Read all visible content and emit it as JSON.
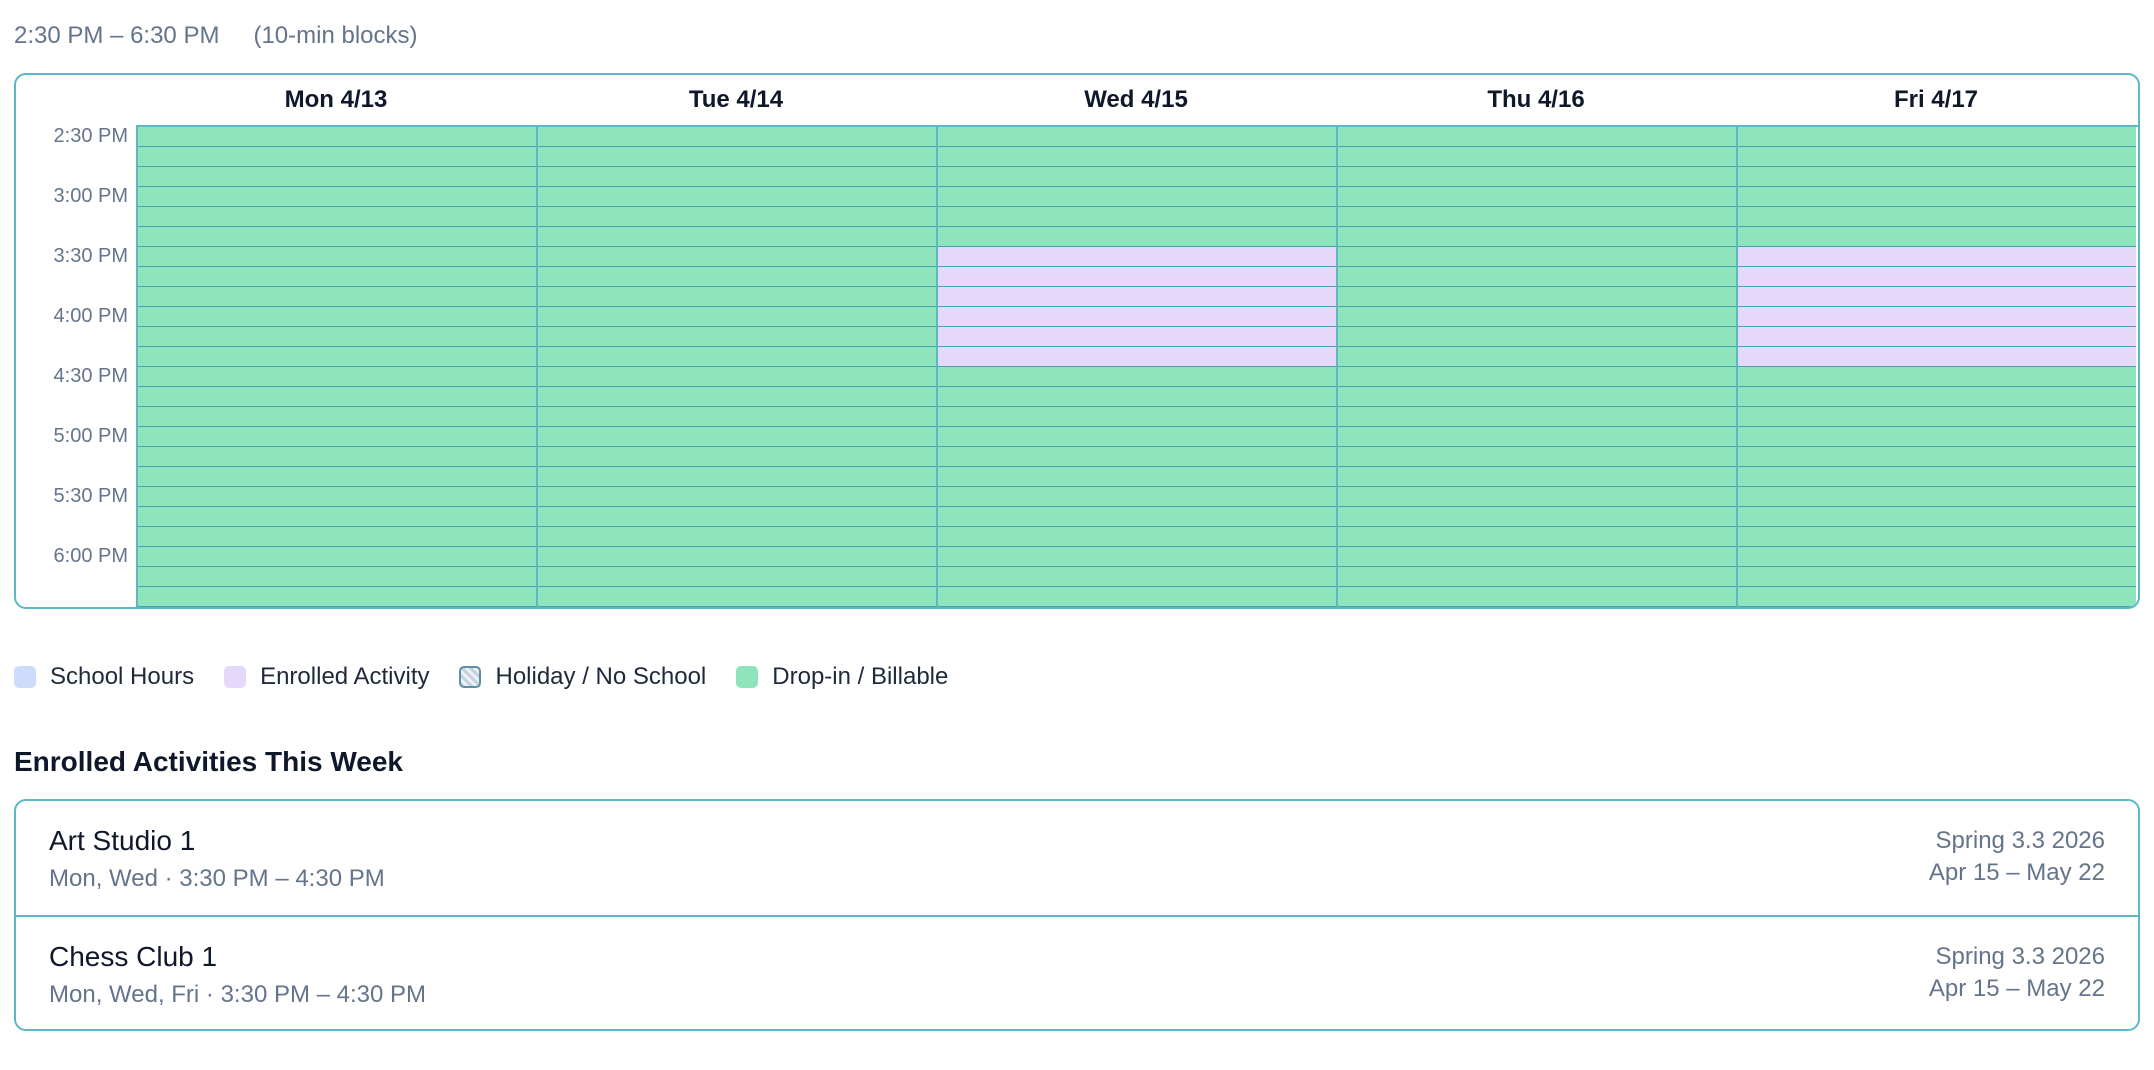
{
  "range": {
    "text": "2:30 PM – 6:30 PM",
    "note": "(10-min blocks)"
  },
  "days": [
    {
      "label": "Mon 4/13",
      "cells": [
        "d",
        "d",
        "d",
        "d",
        "d",
        "d",
        "d",
        "d",
        "d",
        "d",
        "d",
        "d",
        "d",
        "d",
        "d",
        "d",
        "d",
        "d",
        "d",
        "d",
        "d",
        "d",
        "d",
        "d"
      ]
    },
    {
      "label": "Tue 4/14",
      "cells": [
        "d",
        "d",
        "d",
        "d",
        "d",
        "d",
        "d",
        "d",
        "d",
        "d",
        "d",
        "d",
        "d",
        "d",
        "d",
        "d",
        "d",
        "d",
        "d",
        "d",
        "d",
        "d",
        "d",
        "d"
      ]
    },
    {
      "label": "Wed 4/15",
      "cells": [
        "d",
        "d",
        "d",
        "d",
        "d",
        "d",
        "e",
        "e",
        "e",
        "e",
        "e",
        "e",
        "d",
        "d",
        "d",
        "d",
        "d",
        "d",
        "d",
        "d",
        "d",
        "d",
        "d",
        "d"
      ]
    },
    {
      "label": "Thu 4/16",
      "cells": [
        "d",
        "d",
        "d",
        "d",
        "d",
        "d",
        "d",
        "d",
        "d",
        "d",
        "d",
        "d",
        "d",
        "d",
        "d",
        "d",
        "d",
        "d",
        "d",
        "d",
        "d",
        "d",
        "d",
        "d"
      ]
    },
    {
      "label": "Fri 4/17",
      "cells": [
        "d",
        "d",
        "d",
        "d",
        "d",
        "d",
        "e",
        "e",
        "e",
        "e",
        "e",
        "e",
        "d",
        "d",
        "d",
        "d",
        "d",
        "d",
        "d",
        "d",
        "d",
        "d",
        "d",
        "d"
      ]
    }
  ],
  "time_labels": [
    "2:30 PM",
    "3:00 PM",
    "3:30 PM",
    "4:00 PM",
    "4:30 PM",
    "5:00 PM",
    "5:30 PM",
    "6:00 PM"
  ],
  "cell_codes": {
    "d": "Drop-in / Billable",
    "e": "Enrolled Activity"
  },
  "legend": [
    {
      "label": "School Hours",
      "color": "#cddcfa",
      "kind": "school"
    },
    {
      "label": "Enrolled Activity",
      "color": "#e4d8fb",
      "kind": "enrolled"
    },
    {
      "label": "Holiday / No School",
      "color": "#c7d3dc",
      "kind": "holiday"
    },
    {
      "label": "Drop-in / Billable",
      "color": "#8ee4bc",
      "kind": "dropin"
    }
  ],
  "activities_title": "Enrolled Activities This Week",
  "activities": [
    {
      "name": "Art Studio 1",
      "schedule": "Mon, Wed · 3:30 PM – 4:30 PM",
      "session": "Spring 3.3 2026",
      "dates": "Apr 15 – May 22"
    },
    {
      "name": "Chess Club 1",
      "schedule": "Mon, Wed, Fri · 3:30 PM – 4:30 PM",
      "session": "Spring 3.3 2026",
      "dates": "Apr 15 – May 22"
    }
  ],
  "colors": {
    "accent_border": "#5bb8c4",
    "dropin": "#8ee4bc",
    "enrolled": "#e4d8fb",
    "school": "#cddcfa",
    "muted_text": "#64748b"
  }
}
